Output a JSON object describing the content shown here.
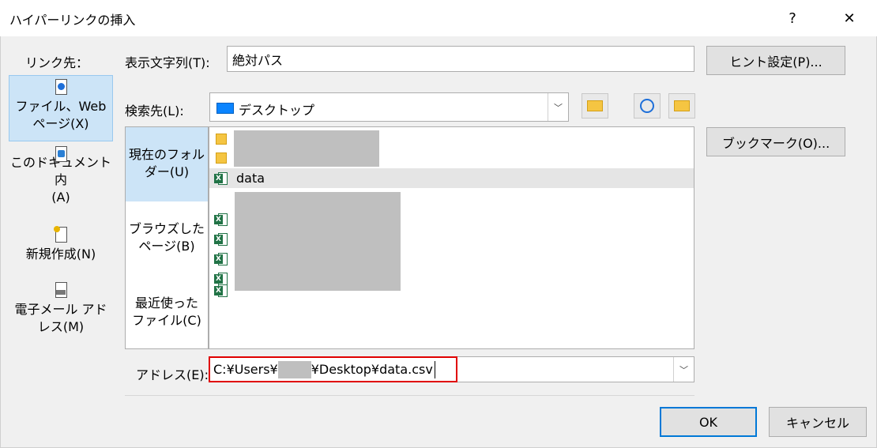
{
  "window": {
    "title": "ハイパーリンクの挿入",
    "help_label": "?",
    "close_label": "✕"
  },
  "link_to": {
    "label": "リンク先：",
    "items": [
      {
        "line1": "ファイル、Web",
        "line2": "ページ(X)",
        "icon": "web-file-icon"
      },
      {
        "line1": "このドキュメント内",
        "line2": "(A)",
        "icon": "document-place-icon"
      },
      {
        "line1": "新規作成(N)",
        "line2": "",
        "icon": "new-document-icon"
      },
      {
        "line1": "電子メール アド",
        "line2": "レス(M)",
        "icon": "email-icon"
      }
    ]
  },
  "display_text": {
    "label": "表示文字列(T):",
    "value": "絶対パス"
  },
  "screen_tip_button": "ヒント設定(P)...",
  "look_in": {
    "label": "検索先(L):",
    "value": "デスクトップ"
  },
  "bookmark_button": "ブックマーク(O)...",
  "scope": {
    "items": [
      {
        "line1": "現在のフォル",
        "line2": "ダー(U)"
      },
      {
        "line1": "ブラウズした",
        "line2": "ページ(B)"
      },
      {
        "line1": "最近使った",
        "line2": "ファイル(C)"
      }
    ]
  },
  "files": [
    {
      "name": "",
      "type": "folder"
    },
    {
      "name": "",
      "type": "folder"
    },
    {
      "name": "data",
      "type": "excel"
    },
    {
      "name": "",
      "type": "excel"
    },
    {
      "name": "",
      "type": "excel"
    },
    {
      "name": "",
      "type": "excel"
    },
    {
      "name": "",
      "type": "excel"
    },
    {
      "name": "",
      "type": "excel"
    }
  ],
  "address": {
    "label": "アドレス(E):",
    "part1": "C:¥Users¥",
    "part2": "¥Desktop¥data.csv"
  },
  "ok_button": "OK",
  "cancel_button": "キャンセル",
  "colors": {
    "selection": "#cce4f7",
    "highlight_border": "#e00000",
    "excel_green": "#217346",
    "default_button_border": "#0078d7"
  }
}
